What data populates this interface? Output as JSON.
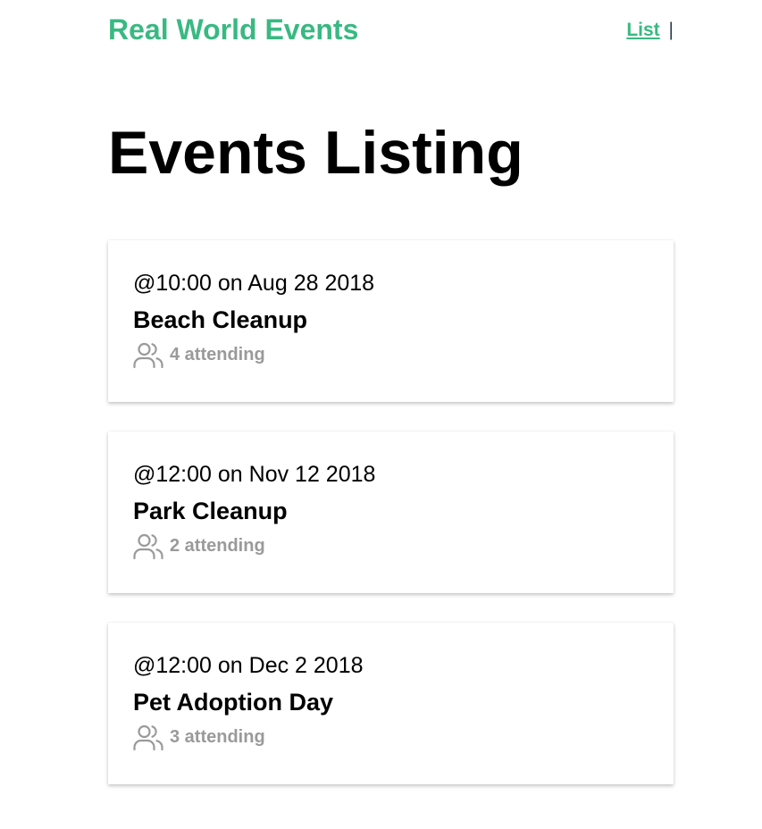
{
  "app": {
    "brand": "Real World Events",
    "nav": {
      "list_label": "List",
      "separator": "|"
    },
    "colors": {
      "brand": "#39b982",
      "muted": "#9a9a9a"
    }
  },
  "page": {
    "title": "Events Listing"
  },
  "events": [
    {
      "time": "@10:00 on Aug 28 2018",
      "title": "Beach Cleanup",
      "attending": "4 attending",
      "icon": "users-icon"
    },
    {
      "time": "@12:00 on Nov 12 2018",
      "title": "Park Cleanup",
      "attending": "2 attending",
      "icon": "users-icon"
    },
    {
      "time": "@12:00 on Dec 2 2018",
      "title": "Pet Adoption Day",
      "attending": "3 attending",
      "icon": "users-icon"
    }
  ]
}
